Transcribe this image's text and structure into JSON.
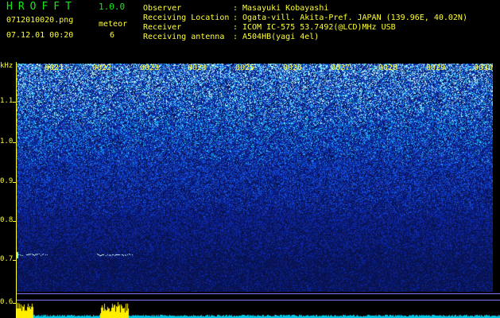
{
  "header": {
    "app_title": "HROFFT",
    "app_version": "1.0.0",
    "filename": "0712010020.png",
    "datetime": "07.12.01 00:20",
    "meteor_label": "meteor",
    "meteor_count": "6"
  },
  "info": [
    {
      "key": "Observer",
      "value": "Masayuki Kobayashi"
    },
    {
      "key": "Receiving Location",
      "value": "Ogata-vill. Akita-Pref. JAPAN (139.96E, 40.02N)"
    },
    {
      "key": "Receiver",
      "value": "ICOM IC-575 53.7492(@LCD)MHz USB"
    },
    {
      "key": "Receiving antenna",
      "value": "A504HB(yagi 4el)"
    }
  ],
  "axis": {
    "unit": "kHz",
    "freq_ticks": [
      "1.1",
      "1.0",
      "0.9",
      "0.8",
      "0.7",
      "0.6"
    ],
    "time_ticks": [
      "0021",
      "0022",
      "0023",
      "0024",
      "0025",
      "0026",
      "0027",
      "0028",
      "0029",
      "0030"
    ]
  },
  "colors": {
    "text": "#ffff33",
    "title": "#19e619",
    "noise_bright": "#33e0ff",
    "noise_dark": "#0a1040",
    "power": "#ffee00",
    "baseline": "#00c8e6"
  }
}
